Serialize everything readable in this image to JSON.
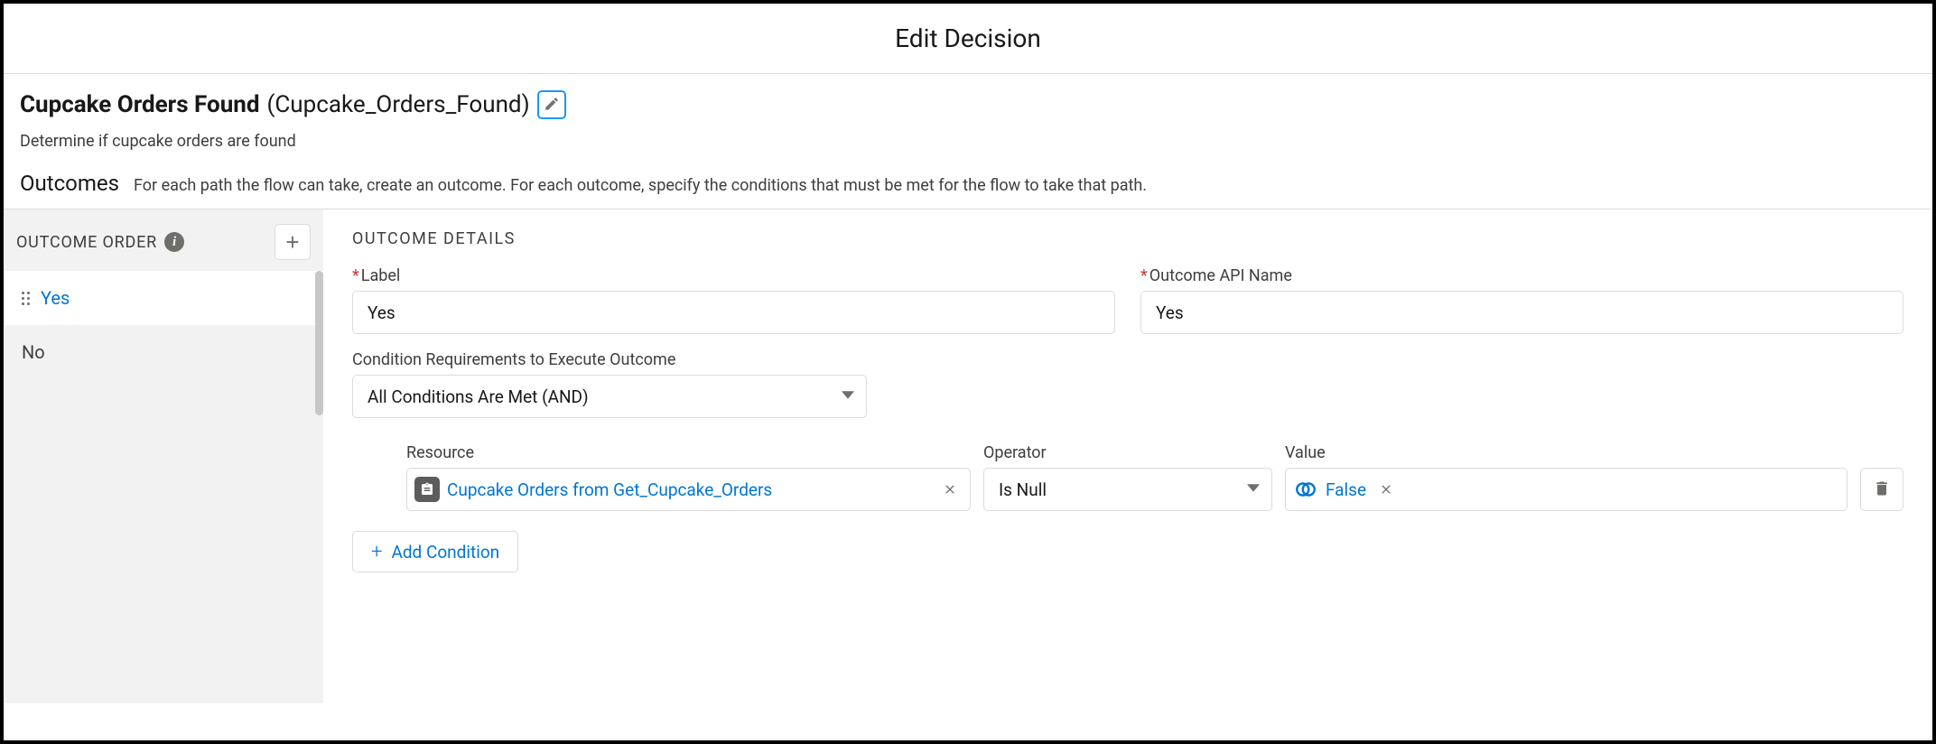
{
  "header": {
    "title": "Edit Decision"
  },
  "decision": {
    "label": "Cupcake Orders Found",
    "api_name": "(Cupcake_Orders_Found)",
    "description": "Determine if cupcake orders are found"
  },
  "outcomes": {
    "title": "Outcomes",
    "subtitle": "For each path the flow can take, create an outcome. For each outcome, specify the conditions that must be met for the flow to take that path."
  },
  "sidebar": {
    "header_label": "OUTCOME ORDER",
    "items": [
      {
        "label": "Yes",
        "active": true
      },
      {
        "label": "No",
        "active": false
      }
    ]
  },
  "details": {
    "header": "OUTCOME DETAILS",
    "label_field": {
      "label": "Label",
      "value": "Yes"
    },
    "api_field": {
      "label": "Outcome API Name",
      "value": "Yes"
    },
    "condition_req": {
      "label": "Condition Requirements to Execute Outcome",
      "value": "All Conditions Are Met (AND)"
    },
    "condition": {
      "resource_label": "Resource",
      "resource_value": "Cupcake Orders from Get_Cupcake_Orders",
      "operator_label": "Operator",
      "operator_value": "Is Null",
      "value_label": "Value",
      "value_value": "False"
    },
    "add_condition_label": "Add Condition"
  }
}
